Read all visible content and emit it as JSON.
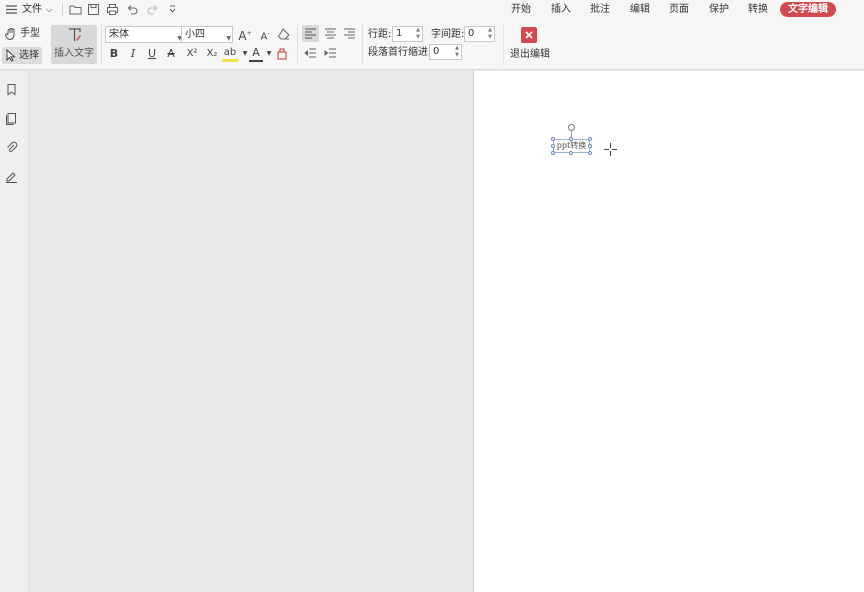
{
  "menubar": {
    "file_label": "文件",
    "tabs": [
      {
        "label": "开始"
      },
      {
        "label": "插入"
      },
      {
        "label": "批注"
      },
      {
        "label": "编辑"
      },
      {
        "label": "页面"
      },
      {
        "label": "保护"
      },
      {
        "label": "转换"
      },
      {
        "label": "文字编辑"
      }
    ],
    "active_tab": "文字编辑",
    "active_color": "#d24a4f"
  },
  "ribbon": {
    "hand_label": "手型",
    "select_label": "选择",
    "insert_text_label": "插入文字",
    "font_name": "宋体",
    "font_size": "小四",
    "line_spacing_label": "行距:",
    "line_spacing_value": "1",
    "char_spacing_label": "字间距:",
    "char_spacing_value": "0",
    "indent_label": "段落首行缩进:",
    "indent_value": "0",
    "exit_label": "退出编辑",
    "exit_color": "#d24a4f",
    "format_glyphs": {
      "bold": "B",
      "italic": "I",
      "underline": "U",
      "strike": "A",
      "superscript": "X²",
      "subscript": "X₂",
      "highlight": "ab",
      "font_color": "A"
    }
  },
  "document": {
    "textbox_text": "ppt转换"
  },
  "icons": [
    "menu-icon",
    "open-icon",
    "save-icon",
    "print-icon",
    "undo-icon",
    "redo-icon",
    "more-icon",
    "hand-icon",
    "cursor-icon",
    "bookmark-icon",
    "pages-icon",
    "attachment-icon",
    "signature-icon",
    "close-icon"
  ]
}
